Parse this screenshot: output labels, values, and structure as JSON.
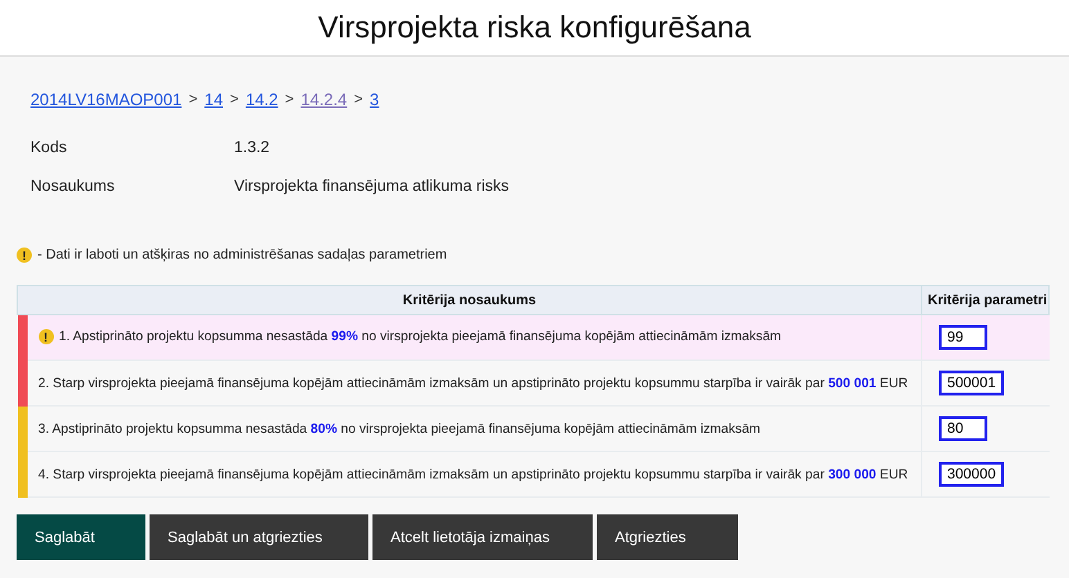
{
  "title": "Virsprojekta riska konfigurēšana",
  "breadcrumb": [
    {
      "label": "2014LV16MAOP001",
      "visited": false,
      "separator": ">"
    },
    {
      "label": "14",
      "visited": false,
      "separator": ">"
    },
    {
      "label": "14.2",
      "visited": false,
      "separator": ">"
    },
    {
      "label": "14.2.4",
      "visited": true,
      "separator": ">"
    },
    {
      "label": "3",
      "visited": false
    }
  ],
  "fields": [
    {
      "label": "Kods",
      "value": "1.3.2"
    },
    {
      "label": "Nosaukums",
      "value": "Virsprojekta finansējuma atlikuma risks"
    }
  ],
  "legend": {
    "icon": "!",
    "text": "- Dati ir laboti un atšķiras no administrēšanas sadaļas parametriem"
  },
  "table": {
    "columns": [
      "Kritērija nosaukums",
      "Kritērija parametri"
    ],
    "rows": [
      {
        "text": "1. Apstiprināto projektu kopsumma nesastāda **99%** no virsprojekta pieejamā finansējuma kopējām attiecināmām izmaksām",
        "value": "99",
        "color": "#f04b55",
        "changed": true
      },
      {
        "text": "2. Starp virsprojekta pieejamā finansējuma kopējām attiecināmām izmaksām un apstiprināto projektu kopsummu starpība ir vairāk par **500 001** EUR",
        "value": "500001",
        "color": "#f04b55",
        "changed": false
      },
      {
        "text": "3. Apstiprināto projektu kopsumma nesastāda **80%** no virsprojekta pieejamā finansējuma kopējām attiecināmām izmaksām",
        "value": "80",
        "color": "#f0c020",
        "changed": false
      },
      {
        "text": "4. Starp virsprojekta pieejamā finansējuma kopējām attiecināmām izmaksām un apstiprināto projektu kopsummu starpība ir vairāk par **300 000** EUR",
        "value": "300000",
        "color": "#f0c020",
        "changed": false
      }
    ]
  },
  "buttons": [
    {
      "label": "Saglabāt",
      "kind": "primary"
    },
    {
      "label": "Saglabāt un atgriezties",
      "kind": "default"
    },
    {
      "label": "Atcelt lietotāja izmaiņas",
      "kind": "default"
    },
    {
      "label": "Atgriezties",
      "kind": "default"
    }
  ]
}
